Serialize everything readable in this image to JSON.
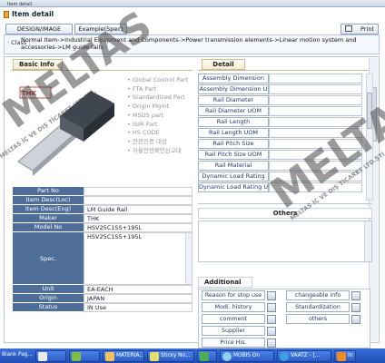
{
  "window_title": "Item detail",
  "header": {
    "title": "Item detail"
  },
  "toolbar": {
    "design_image": "DESIGN/IMAGE",
    "example_spec": "Example(Spec)",
    "print": "Print"
  },
  "classification": {
    "label": "Class",
    "line1": "Normal Item->Industrial Equipment and Components->Power transmission elements->Linear motion system and",
    "line2": "accessories->LM guide rails"
  },
  "basic_info": {
    "title": "Basic Info",
    "links": [
      "Global Control Part",
      "FTA Part",
      "Standardized Part",
      "Origin Mgmt",
      "MSDS part",
      "ISIR Part",
      "HS CODE",
      "안전인증 대상",
      "자율안전확인신고대"
    ],
    "fields": [
      {
        "label": "Part No",
        "value": ""
      },
      {
        "label": "Item Desc(Loc)",
        "value": ""
      },
      {
        "label": "Item Desc(Eng)",
        "value": "LM Guide Rail"
      },
      {
        "label": "Maker",
        "value": "THK"
      },
      {
        "label": "Model No",
        "value": "HSV25C1SS+195L"
      },
      {
        "label": "Spec.",
        "value": "HSV25C1SS+195L"
      },
      {
        "label": "Unit",
        "value": "EA-EACH"
      },
      {
        "label": "Origin",
        "value": "JAPAN"
      },
      {
        "label": "Status",
        "value": "IN Use"
      }
    ]
  },
  "detail": {
    "title": "Detail",
    "rows": [
      "Assembly Dimension",
      "Assembly Dimension U",
      "Rail Diameter",
      "Rail Diameter UOM",
      "Rail Length",
      "Rail Length UOM",
      "Rail Pitch Size",
      "Rail Pitch Size UOM",
      "Rail Material",
      "Dynamic Load Rating",
      "Dynamic Load Rating U"
    ]
  },
  "others": {
    "title": "Others"
  },
  "additional_info": {
    "title": "Additional info",
    "left": [
      "Reason for stop use",
      "Modi. history",
      "comment",
      "Supplier",
      "Price His."
    ],
    "right": [
      "changeable info",
      "Standardization",
      "others"
    ]
  },
  "watermark": {
    "text": "MELTAS",
    "sub": "MELTAS İÇ VE DIŞ TİCARET LTD.ŞTİ."
  },
  "taskbar": {
    "items": [
      "Blank Pag...",
      "",
      "",
      "MATERIA...",
      "Sticky No...",
      "",
      "MOBIS On",
      "VAATZ - [...",
      "In"
    ]
  },
  "colors": {
    "label_bg": "#4f6d99",
    "taskbar": "#2b5cc8",
    "tab_header": "#f3ecd2"
  }
}
